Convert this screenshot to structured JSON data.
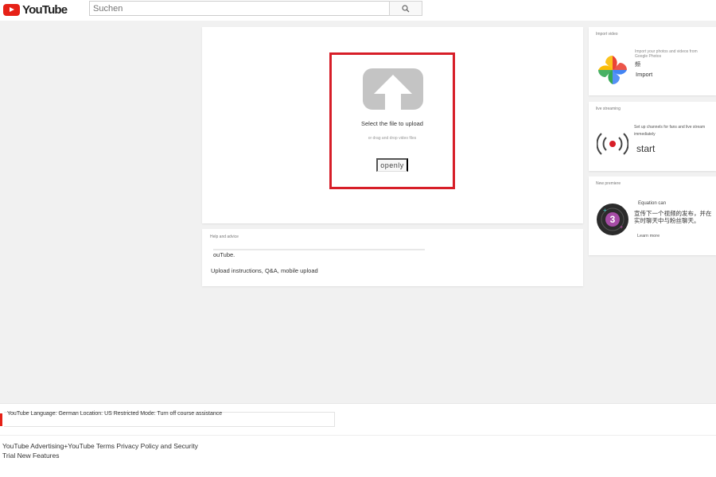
{
  "header": {
    "logo_text": "YouTube",
    "search_placeholder": "Suchen"
  },
  "upload": {
    "title": "Select the file to upload",
    "subtitle": "or drag and drop video files",
    "open_label": "openly"
  },
  "help": {
    "heading": "Help and advice",
    "text": "ouTube.",
    "link": "Upload instructions, Q&A, mobile upload"
  },
  "import_video": {
    "heading": "Import video",
    "faint": "Import your photos and videos from Google Photos",
    "text": "频",
    "action": "Import"
  },
  "live_streaming": {
    "heading": "live streaming",
    "text": "Set up channels for fans and live stream immediately",
    "action": "start"
  },
  "premiere": {
    "heading": "New premiere",
    "label": "Equation can",
    "text": "宣传下一个视频的发布，并在实时聊天中与粉丝聊天。",
    "action": "Learn more"
  },
  "language_bar": {
    "text": "YouTube Language: German Location: US Restricted Mode: Turn off course assistance"
  },
  "footer": {
    "line1": "YouTube Advertising+YouTube Terms Privacy Policy and Security",
    "line2": "Trial New Features"
  },
  "colors": {
    "brand_red": "#e62117",
    "highlight_border": "#d71e28",
    "upload_icon_gray": "#c4c4c4"
  }
}
